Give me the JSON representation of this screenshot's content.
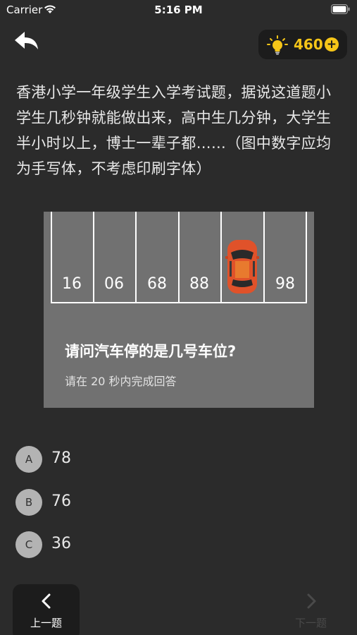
{
  "status_bar": {
    "carrier": "Carrier",
    "time": "5:16 PM"
  },
  "header": {
    "points": "460",
    "plus": "+"
  },
  "question": {
    "text": "香港小学一年级学生入学考试题，据说这道题小学生几秒钟就能做出来，高中生几分钟，大学生半小时以上，博士一辈子都……（图中数字应均为手写体，不考虑印刷字体）"
  },
  "puzzle": {
    "stalls": [
      "16",
      "06",
      "68",
      "88",
      "",
      "98"
    ],
    "question": "请问汽车停的是几号车位?",
    "hint": "请在 20 秒内完成回答"
  },
  "options": [
    {
      "letter": "A",
      "value": "78"
    },
    {
      "letter": "B",
      "value": "76"
    },
    {
      "letter": "C",
      "value": "36"
    }
  ],
  "nav": {
    "prev_label": "上一题",
    "next_label": "下一题"
  },
  "colors": {
    "accent": "#f5c518",
    "background": "#2b2b2b",
    "car": "#e0522a"
  }
}
